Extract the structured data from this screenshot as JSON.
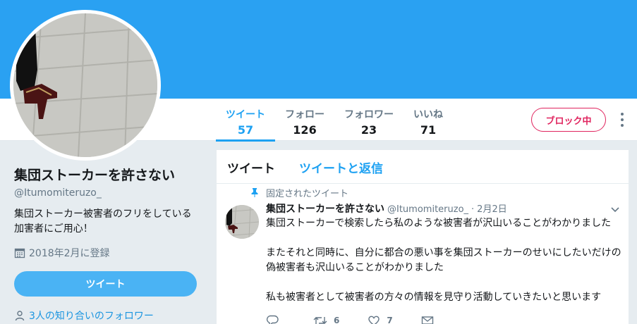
{
  "stats": [
    {
      "label": "ツイート",
      "value": "57"
    },
    {
      "label": "フォロー",
      "value": "126"
    },
    {
      "label": "フォロワー",
      "value": "23"
    },
    {
      "label": "いいね",
      "value": "71"
    }
  ],
  "block_label": "ブロック中",
  "profile": {
    "name": "集団ストーカーを許さない",
    "handle": "@Itumomiteruzo_",
    "bio_line1": "集団ストーカー被害者のフリをしている",
    "bio_line2": "加害者にご用心！",
    "joined": "2018年2月に登録",
    "tweet_button": "ツイート",
    "followers_you_know": "3人の知り合いのフォロワー"
  },
  "tabs": {
    "tweets": "ツイート",
    "tweets_replies": "ツイートと返信"
  },
  "pinned_label": "固定されたツイート",
  "tweet": {
    "name": "集団ストーカーを許さない",
    "handle": "@Itumomiteruzo_",
    "separator": "·",
    "date": "2月2日",
    "line1": "集団ストーカーで検索したら私のような被害者が沢山いることがわかりました",
    "line2": "またそれと同時に、自分に都合の悪い事を集団ストーカーのせいにしたいだけの",
    "line3": "偽被害者も沢山いることがわかりました",
    "line4": "私も被害者として被害者の方々の情報を見守り活動していきたいと思います",
    "retweets": "6",
    "likes": "7"
  },
  "colors": {
    "banner": "#2aa1f2",
    "accent": "#1da1f2",
    "block": "#e0245e",
    "tweet_button": "#4ab3f4"
  },
  "icons": {
    "pin": "pin-icon",
    "calendar": "calendar-icon",
    "person": "person-icon",
    "reply": "reply-icon",
    "retweet": "retweet-icon",
    "like": "heart-icon",
    "dm": "envelope-icon",
    "caret": "chevron-down-icon",
    "more": "more-vertical-icon"
  }
}
